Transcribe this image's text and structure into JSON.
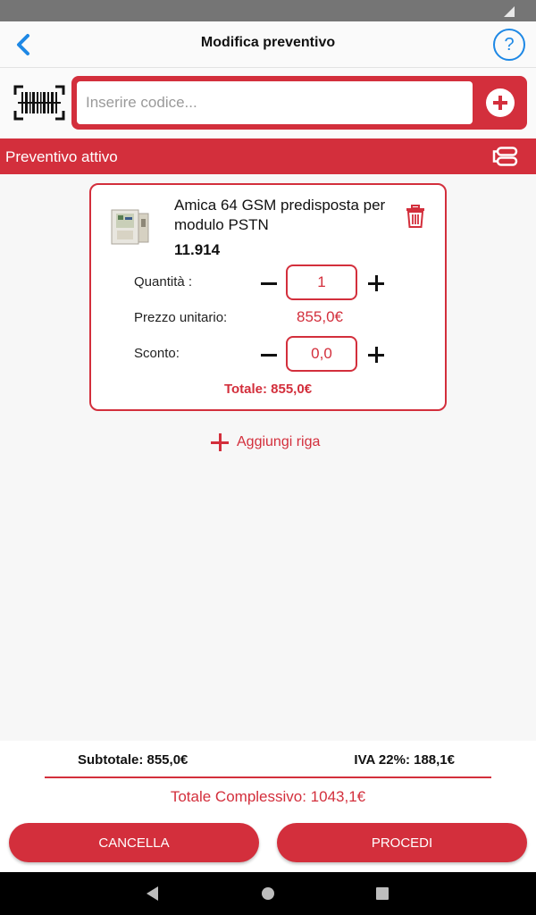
{
  "app": {
    "title": "Modifica preventivo"
  },
  "search": {
    "placeholder": "Inserire codice..."
  },
  "section": {
    "title": "Preventivo attivo"
  },
  "item": {
    "name": "Amica 64 GSM predisposta per modulo PSTN",
    "code": "11.914",
    "quantity_label": "Quantità :",
    "quantity": "1",
    "unit_price_label": "Prezzo unitario:",
    "unit_price": "855,0€",
    "discount_label": "Sconto:",
    "discount": "0,0",
    "total": "Totale: 855,0€"
  },
  "add_row": {
    "label": "Aggiungi riga"
  },
  "summary": {
    "subtotal": "Subtotale: 855,0€",
    "iva": "IVA 22%: 188,1€",
    "grand_total": "Totale Complessivo: 1043,1€"
  },
  "buttons": {
    "cancel": "CANCELLA",
    "proceed": "PROCEDI"
  },
  "colors": {
    "accent": "#d32f3c",
    "help": "#1e88e5"
  },
  "icons": {
    "back": "chevron-left-icon",
    "help": "question-mark-icon",
    "barcode": "barcode-scanner-icon",
    "add_code": "plus-circle-icon",
    "toggle": "list-toggle-icon",
    "delete": "trash-icon",
    "add_row": "plus-icon"
  }
}
